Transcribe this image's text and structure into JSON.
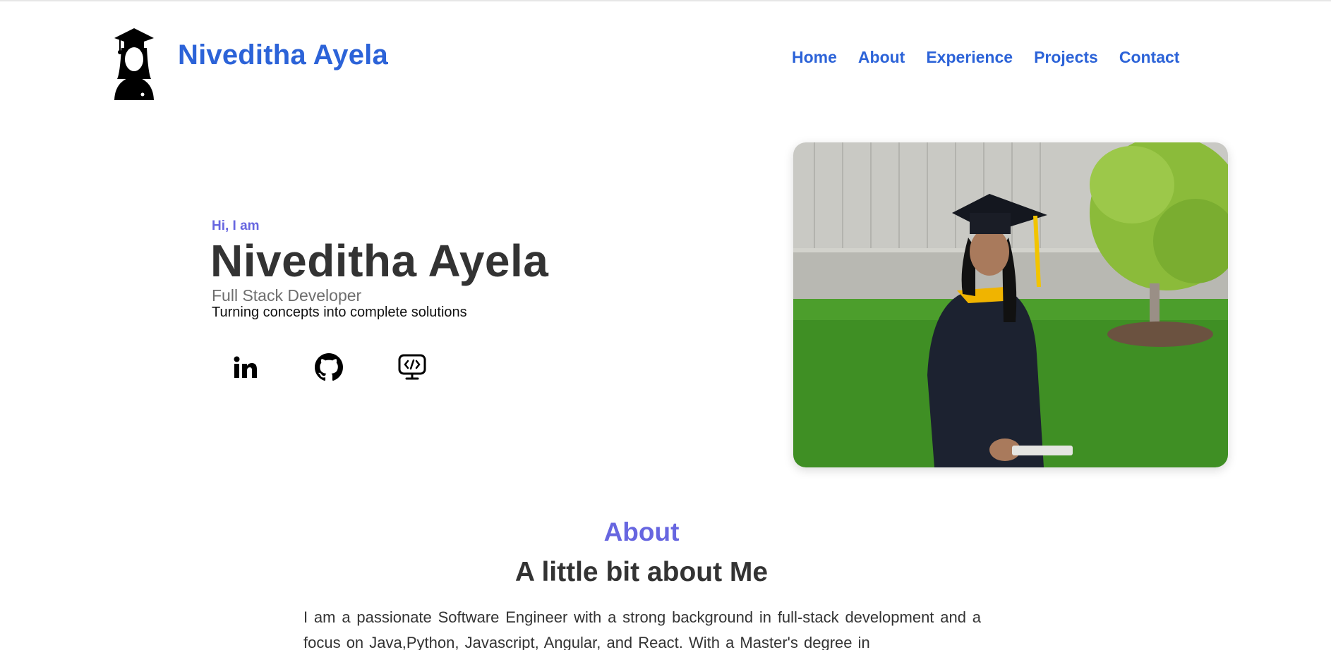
{
  "header": {
    "brand": "Niveditha Ayela",
    "logo_icon": "graduate-avatar-icon",
    "nav": [
      "Home",
      "About",
      "Experience",
      "Projects",
      "Contact"
    ]
  },
  "hero": {
    "greeting": "Hi, I am",
    "name": "Niveditha Ayela",
    "role": "Full Stack Developer",
    "tagline": "Turning concepts into complete solutions",
    "socials": [
      "linkedin-icon",
      "github-icon",
      "code-monitor-icon"
    ],
    "photo_icon": "graduation-photo"
  },
  "about": {
    "label": "About",
    "title": "A little bit about Me",
    "text": "I am a passionate Software Engineer with a strong background in full-stack development and a focus on Java,Python, Javascript, Angular, and React. With a Master's degree in"
  },
  "colors": {
    "brand_blue": "#2c63d8",
    "accent_purple": "#6766e0",
    "text_dark": "#333333"
  }
}
